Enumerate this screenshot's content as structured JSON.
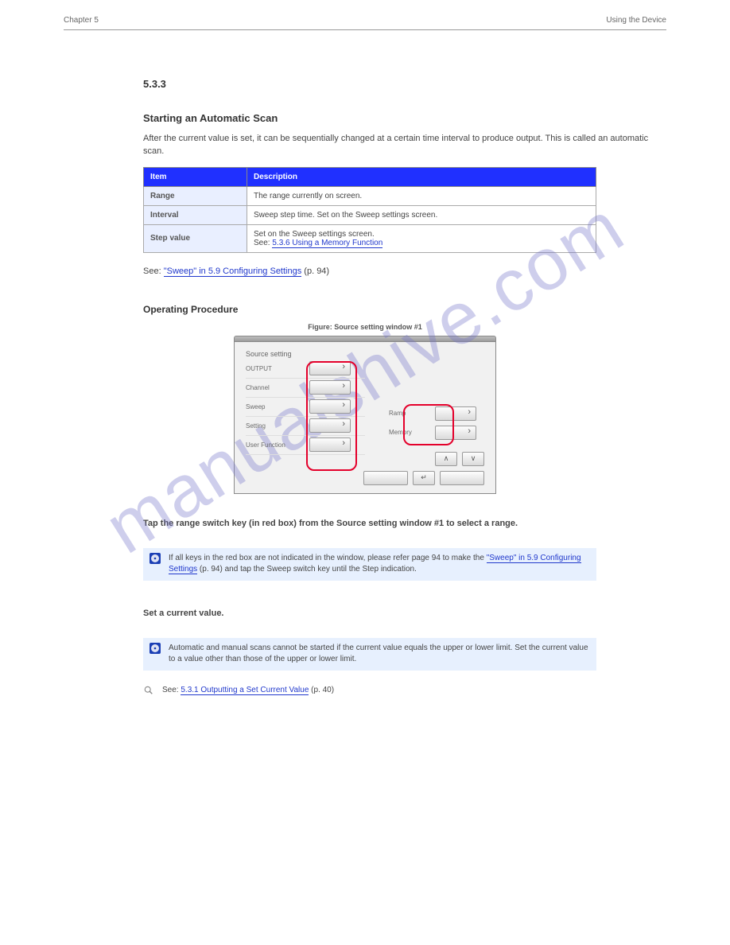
{
  "header": {
    "left": "Chapter 5",
    "right": "Using the Device"
  },
  "section": {
    "number": "5.3.3",
    "label_prefix": "5.3.3",
    "title": "Starting an Automatic Scan",
    "intro": "After the current value is set, it can be sequentially changed at a certain time interval to produce output. This is called an automatic scan."
  },
  "table": {
    "headers": [
      "Item",
      "Description"
    ],
    "rows": [
      {
        "lab": "Range",
        "desc": "The range currently on screen."
      },
      {
        "lab": "Interval",
        "desc": "Sweep step time. Set on the Sweep settings screen."
      },
      {
        "lab": "Step value",
        "desc_prefix": "Set on the Sweep settings screen.",
        "desc_link_label": "See:",
        "desc_link": "5.3.6 Using a Memory Function"
      }
    ]
  },
  "see_ref": {
    "prefix": "See:",
    "link": "\"Sweep\" in 5.9 Configuring Settings",
    "page": " (p. 94)"
  },
  "subheading": "Operating Procedure",
  "figure": {
    "caption": "Figure: Source setting window #1",
    "title": "Source setting",
    "rows_left": [
      "OUTPUT",
      "Channel",
      "Sweep",
      "Setting",
      "User Function"
    ],
    "rows_right": [
      "Ramp",
      "Memory"
    ]
  },
  "step1": "Tap the range switch key (in red box) from the Source setting window #1 to select a range.",
  "callout1": {
    "text_prefix": "If all keys in the red box are not indicated in the window, please refer page 94 to make the",
    "link": "\"Sweep\" in 5.9 Configuring Settings",
    "text_suffix": "(p. 94) and tap the Sweep switch key until the Step indication."
  },
  "step2": "Set a current value.",
  "callout2": {
    "text": "Automatic and manual scans cannot be started if the current value equals the upper or lower limit. Set the current value to a value other than those of the upper or lower limit."
  },
  "callout3": {
    "prefix": "See:",
    "link": "5.3.1 Outputting a Set Current Value",
    "page": " (p. 40)"
  },
  "watermark": "manualshive.com"
}
